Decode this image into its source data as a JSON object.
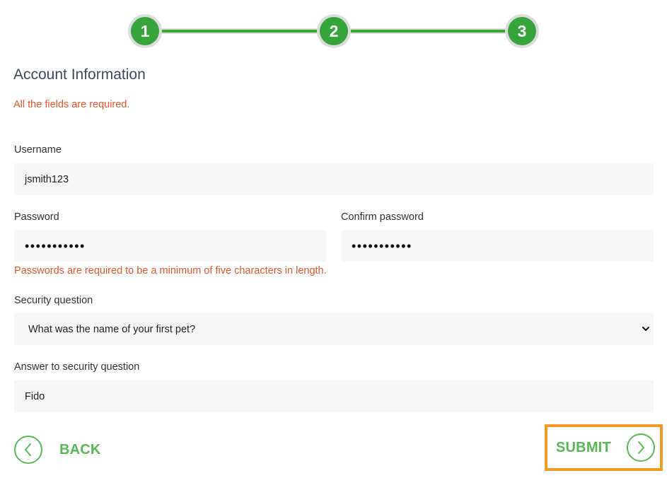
{
  "stepper": {
    "steps": [
      {
        "number": "1"
      },
      {
        "number": "2"
      },
      {
        "number": "3"
      }
    ],
    "current_step": 3
  },
  "form": {
    "title": "Account Information",
    "required_note": "All the fields are required.",
    "username": {
      "label": "Username",
      "value": "jsmith123"
    },
    "password": {
      "label": "Password",
      "value_masked": "•••••••••••"
    },
    "confirm_password": {
      "label": "Confirm password",
      "value_masked": "•••••••••••"
    },
    "password_error": "Passwords are required to be a minimum of five characters in length.",
    "security_question": {
      "label": "Security question",
      "selected": "What was the name of your first pet?"
    },
    "security_answer": {
      "label": "Answer to security question",
      "value": "Fido"
    }
  },
  "actions": {
    "back_label": "BACK",
    "submit_label": "SUBMIT"
  },
  "colors": {
    "accent_green": "#5ab857",
    "step_green": "#36a43b",
    "error_red": "#e2542e",
    "highlight_orange": "#f39a26"
  }
}
